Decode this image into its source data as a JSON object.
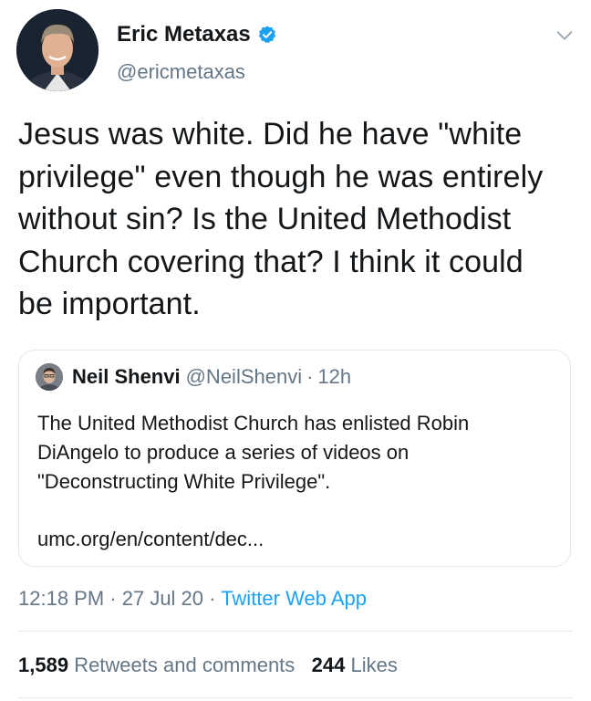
{
  "author": {
    "name": "Eric Metaxas",
    "handle": "@ericmetaxas",
    "verified": true,
    "avatar_icon": "profile-photo"
  },
  "tweet": {
    "text": "Jesus was white. Did he have \"white privilege\" even though he was entirely without sin? Is the United Methodist Church covering that? I think it could be important."
  },
  "quoted_tweet": {
    "name": "Neil Shenvi",
    "handle": "@NeilShenvi",
    "separator": "·",
    "time": "12h",
    "text": "The United Methodist Church has enlisted Robin DiAngelo to produce a series of videos on \"Deconstructing White Privilege\".",
    "link": "umc.org/en/content/dec..."
  },
  "meta": {
    "time": "12:18 PM",
    "sep1": " · ",
    "date": "27 Jul 20",
    "sep2": " · ",
    "source": "Twitter Web App"
  },
  "stats": {
    "retweets_count": "1,589",
    "retweets_label": "Retweets and comments",
    "likes_count": "244",
    "likes_label": "Likes"
  },
  "colors": {
    "link_blue": "#1da1f2",
    "secondary_text": "#657786",
    "border": "#e1e8ed",
    "verified_badge": "#1da1f2"
  }
}
